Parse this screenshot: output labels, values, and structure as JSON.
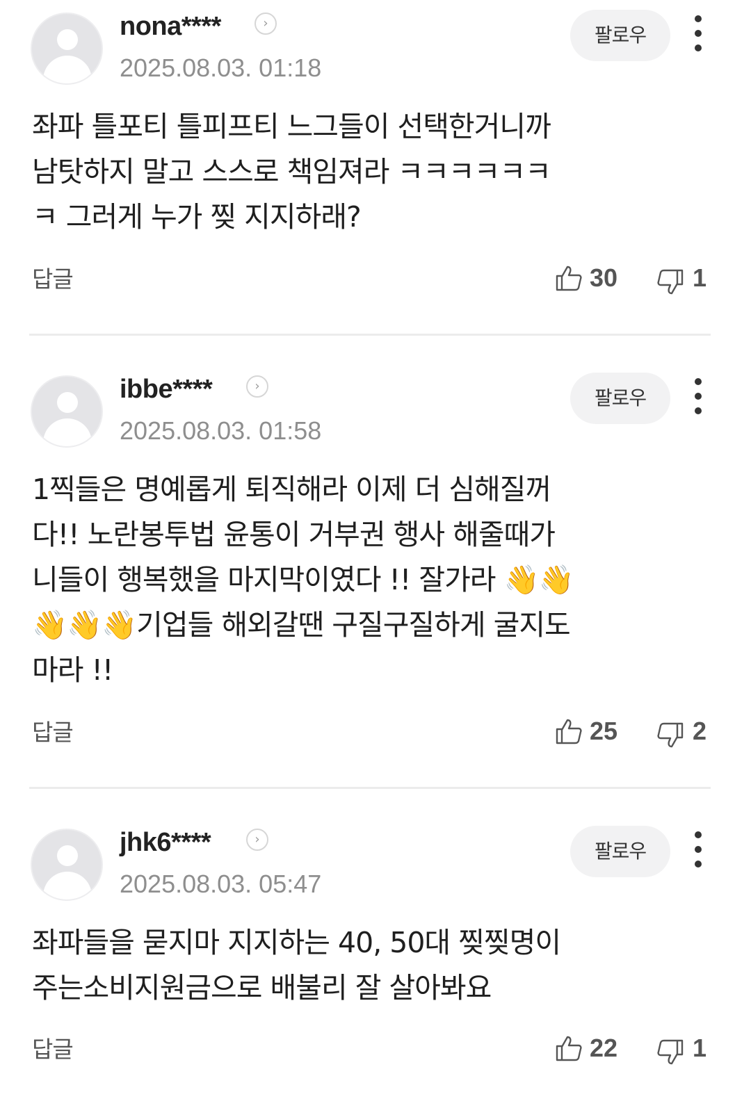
{
  "comments": [
    {
      "username": "nona****",
      "timestamp": "2025.08.03. 01:18",
      "follow_label": "팔로우",
      "body": "좌파 틀포티 틀피프티 느그들이 선택한거니까\n남탓하지 말고 스스로 책임져라 ㅋㅋㅋㅋㅋㅋ\nㅋ 그러게 누가 찢 지지하래?",
      "reply_label": "답글",
      "likes": "30",
      "dislikes": "1"
    },
    {
      "username": "ibbe****",
      "timestamp": "2025.08.03. 01:58",
      "follow_label": "팔로우",
      "body": "1찍들은 명예롭게 퇴직해라 이제 더 심해질꺼\n다!! 노란봉투법 윤통이 거부권 행사 해줄때가\n니들이 행복했을 마지막이였다 !! 잘가라 👋👋\n👋👋👋기업들 해외갈땐 구질구질하게 굴지도\n마라 !!",
      "reply_label": "답글",
      "likes": "25",
      "dislikes": "2"
    },
    {
      "username": "jhk6****",
      "timestamp": "2025.08.03. 05:47",
      "follow_label": "팔로우",
      "body": "좌파들을 묻지마 지지하는 40, 50대 찢찢명이\n주는소비지원금으로 배불리 잘 살아봐요",
      "reply_label": "답글",
      "likes": "22",
      "dislikes": "1"
    }
  ],
  "icons": {
    "profile_link": "chevron-right-icon",
    "more": "more-vertical-icon",
    "like": "thumbs-up-icon",
    "dislike": "thumbs-down-icon",
    "avatar": "default-avatar-icon"
  },
  "colors": {
    "background": "#ffffff",
    "text": "#1f1f1f",
    "muted": "#8e8e8e",
    "follow_bg": "#f2f2f3",
    "divider": "#ececec"
  }
}
